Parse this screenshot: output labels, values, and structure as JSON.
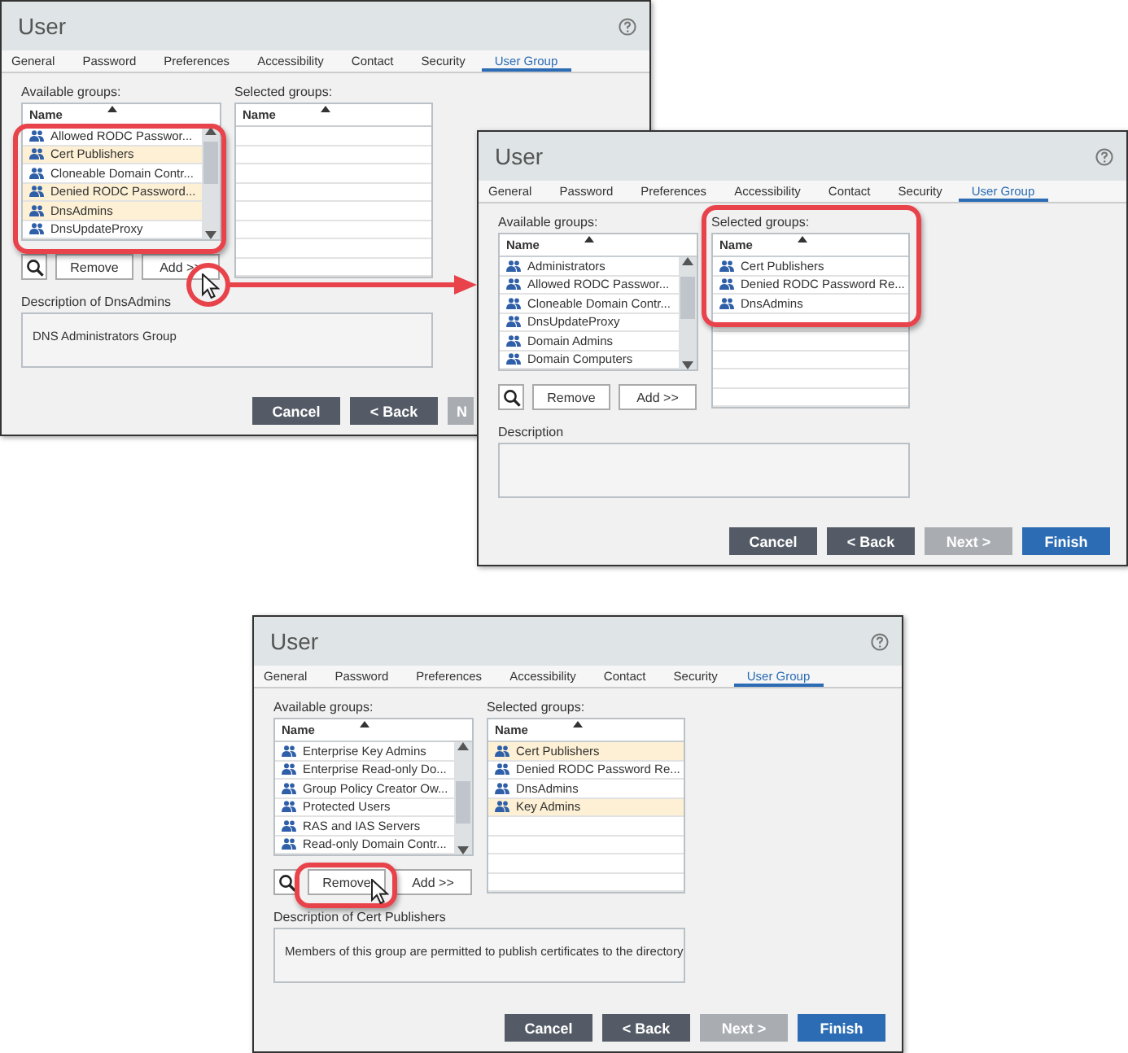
{
  "dialogs": [
    {
      "title": "User",
      "tabs": [
        {
          "label": "General",
          "selected": false
        },
        {
          "label": "Password",
          "selected": false
        },
        {
          "label": "Preferences",
          "selected": false
        },
        {
          "label": "Accessibility",
          "selected": false
        },
        {
          "label": "Contact",
          "selected": false
        },
        {
          "label": "Security",
          "selected": false
        },
        {
          "label": "User Group",
          "selected": true
        }
      ],
      "available": {
        "label": "Available groups:",
        "column": "Name",
        "rows": [
          {
            "name": "Allowed RODC Passwor...",
            "selected": false
          },
          {
            "name": "Cert Publishers",
            "selected": true
          },
          {
            "name": "Cloneable Domain Contr...",
            "selected": false
          },
          {
            "name": "Denied RODC Password...",
            "selected": true
          },
          {
            "name": "DnsAdmins",
            "selected": true
          },
          {
            "name": "DnsUpdateProxy",
            "selected": false
          }
        ]
      },
      "chosen": {
        "label": "Selected groups:",
        "column": "Name"
      },
      "remove": "Remove",
      "add": "Add >>",
      "description": {
        "label": "Description of DnsAdmins",
        "text": "DNS Administrators Group"
      },
      "buttons": [
        {
          "label": "Cancel",
          "kind": "dark"
        },
        {
          "label": "< Back",
          "kind": "dark"
        },
        {
          "label": "N",
          "kind": "disabled"
        }
      ]
    },
    {
      "title": "User",
      "tabs": [
        {
          "label": "General",
          "selected": false
        },
        {
          "label": "Password",
          "selected": false
        },
        {
          "label": "Preferences",
          "selected": false
        },
        {
          "label": "Accessibility",
          "selected": false
        },
        {
          "label": "Contact",
          "selected": false
        },
        {
          "label": "Security",
          "selected": false
        },
        {
          "label": "User Group",
          "selected": true
        }
      ],
      "available": {
        "label": "Available groups:",
        "column": "Name",
        "rows": [
          {
            "name": "Administrators",
            "selected": false
          },
          {
            "name": "Allowed RODC Passwor...",
            "selected": false
          },
          {
            "name": "Cloneable Domain Contr...",
            "selected": false
          },
          {
            "name": "DnsUpdateProxy",
            "selected": false
          },
          {
            "name": "Domain Admins",
            "selected": false
          },
          {
            "name": "Domain Computers",
            "selected": false
          }
        ]
      },
      "chosen": {
        "label": "Selected groups:",
        "column": "Name",
        "rows": [
          {
            "name": "Cert Publishers",
            "selected": false
          },
          {
            "name": "Denied RODC Password Re...",
            "selected": false
          },
          {
            "name": "DnsAdmins",
            "selected": false
          }
        ]
      },
      "remove": "Remove",
      "add": "Add >>",
      "description": {
        "label": "Description"
      },
      "buttons": [
        {
          "label": "Cancel",
          "kind": "dark"
        },
        {
          "label": "< Back",
          "kind": "dark"
        },
        {
          "label": "Next >",
          "kind": "disabled"
        },
        {
          "label": "Finish",
          "kind": "primary"
        }
      ]
    },
    {
      "title": "User",
      "tabs": [
        {
          "label": "General",
          "selected": false
        },
        {
          "label": "Password",
          "selected": false
        },
        {
          "label": "Preferences",
          "selected": false
        },
        {
          "label": "Accessibility",
          "selected": false
        },
        {
          "label": "Contact",
          "selected": false
        },
        {
          "label": "Security",
          "selected": false
        },
        {
          "label": "User Group",
          "selected": true
        }
      ],
      "available": {
        "label": "Available groups:",
        "column": "Name",
        "rows": [
          {
            "name": "Enterprise Key Admins",
            "selected": false
          },
          {
            "name": "Enterprise Read-only Do...",
            "selected": false
          },
          {
            "name": "Group Policy Creator Ow...",
            "selected": false
          },
          {
            "name": "Protected Users",
            "selected": false
          },
          {
            "name": "RAS and IAS Servers",
            "selected": false
          },
          {
            "name": "Read-only Domain Contr...",
            "selected": false
          }
        ]
      },
      "chosen": {
        "label": "Selected groups:",
        "column": "Name",
        "rows": [
          {
            "name": "Cert Publishers",
            "selected": true
          },
          {
            "name": "Denied RODC Password Re...",
            "selected": false
          },
          {
            "name": "DnsAdmins",
            "selected": false
          },
          {
            "name": "Key Admins",
            "selected": true
          }
        ]
      },
      "remove": "Remove",
      "add": "Add >>",
      "description": {
        "label": "Description of Cert Publishers",
        "text": "Members of this group are permitted to publish certificates to the directory"
      },
      "buttons": [
        {
          "label": "Cancel",
          "kind": "dark"
        },
        {
          "label": "< Back",
          "kind": "dark"
        },
        {
          "label": "Next >",
          "kind": "disabled"
        },
        {
          "label": "Finish",
          "kind": "primary"
        }
      ]
    }
  ]
}
